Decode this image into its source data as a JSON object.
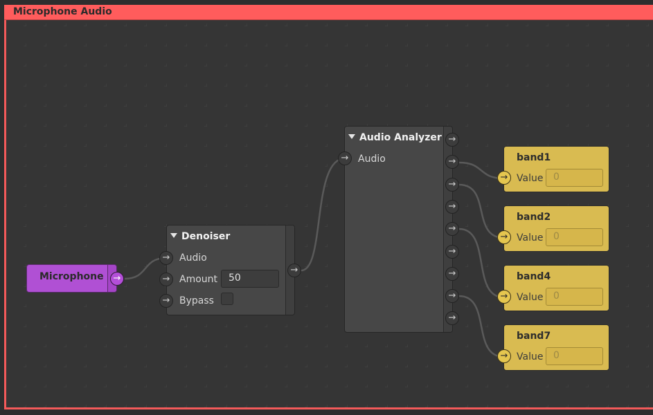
{
  "group": {
    "title": "Microphone Audio",
    "color": "#ff5c5c"
  },
  "nodes": {
    "microphone": {
      "title": "Microphone",
      "color": "#b050d4"
    },
    "denoiser": {
      "title": "Denoiser",
      "inputs": [
        "Audio",
        "Amount",
        "Bypass"
      ],
      "amount_value": "50",
      "bypass_checked": false
    },
    "analyzer": {
      "title": "Audio Analyzer",
      "inputs": [
        "Audio"
      ],
      "output_count": 9
    },
    "bands": [
      {
        "title": "band1",
        "input_label": "Value",
        "value": "0"
      },
      {
        "title": "band2",
        "input_label": "Value",
        "value": "0"
      },
      {
        "title": "band4",
        "input_label": "Value",
        "value": "0"
      },
      {
        "title": "band7",
        "input_label": "Value",
        "value": "0"
      }
    ],
    "band_color": "#d9bb51"
  },
  "connections": [
    {
      "from": "Microphone.out",
      "to": "Denoiser.Audio"
    },
    {
      "from": "Denoiser.out",
      "to": "Audio Analyzer.Audio"
    },
    {
      "from": "Audio Analyzer.out2",
      "to": "band1.Value"
    },
    {
      "from": "Audio Analyzer.out3",
      "to": "band2.Value"
    },
    {
      "from": "Audio Analyzer.out5",
      "to": "band4.Value"
    },
    {
      "from": "Audio Analyzer.out8",
      "to": "band7.Value"
    }
  ],
  "icons": {
    "port": "arrow-right",
    "collapse": "triangle-down"
  }
}
